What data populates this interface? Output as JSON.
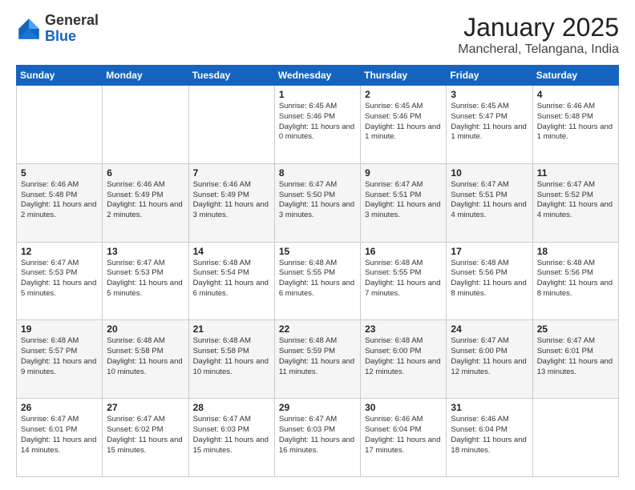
{
  "header": {
    "logo_general": "General",
    "logo_blue": "Blue",
    "month": "January 2025",
    "location": "Mancheral, Telangana, India"
  },
  "days_of_week": [
    "Sunday",
    "Monday",
    "Tuesday",
    "Wednesday",
    "Thursday",
    "Friday",
    "Saturday"
  ],
  "weeks": [
    [
      {
        "day": "",
        "sunrise": "",
        "sunset": "",
        "daylight": ""
      },
      {
        "day": "",
        "sunrise": "",
        "sunset": "",
        "daylight": ""
      },
      {
        "day": "",
        "sunrise": "",
        "sunset": "",
        "daylight": ""
      },
      {
        "day": "1",
        "sunrise": "Sunrise: 6:45 AM",
        "sunset": "Sunset: 5:46 PM",
        "daylight": "Daylight: 11 hours and 0 minutes."
      },
      {
        "day": "2",
        "sunrise": "Sunrise: 6:45 AM",
        "sunset": "Sunset: 5:46 PM",
        "daylight": "Daylight: 11 hours and 1 minute."
      },
      {
        "day": "3",
        "sunrise": "Sunrise: 6:45 AM",
        "sunset": "Sunset: 5:47 PM",
        "daylight": "Daylight: 11 hours and 1 minute."
      },
      {
        "day": "4",
        "sunrise": "Sunrise: 6:46 AM",
        "sunset": "Sunset: 5:48 PM",
        "daylight": "Daylight: 11 hours and 1 minute."
      }
    ],
    [
      {
        "day": "5",
        "sunrise": "Sunrise: 6:46 AM",
        "sunset": "Sunset: 5:48 PM",
        "daylight": "Daylight: 11 hours and 2 minutes."
      },
      {
        "day": "6",
        "sunrise": "Sunrise: 6:46 AM",
        "sunset": "Sunset: 5:49 PM",
        "daylight": "Daylight: 11 hours and 2 minutes."
      },
      {
        "day": "7",
        "sunrise": "Sunrise: 6:46 AM",
        "sunset": "Sunset: 5:49 PM",
        "daylight": "Daylight: 11 hours and 3 minutes."
      },
      {
        "day": "8",
        "sunrise": "Sunrise: 6:47 AM",
        "sunset": "Sunset: 5:50 PM",
        "daylight": "Daylight: 11 hours and 3 minutes."
      },
      {
        "day": "9",
        "sunrise": "Sunrise: 6:47 AM",
        "sunset": "Sunset: 5:51 PM",
        "daylight": "Daylight: 11 hours and 3 minutes."
      },
      {
        "day": "10",
        "sunrise": "Sunrise: 6:47 AM",
        "sunset": "Sunset: 5:51 PM",
        "daylight": "Daylight: 11 hours and 4 minutes."
      },
      {
        "day": "11",
        "sunrise": "Sunrise: 6:47 AM",
        "sunset": "Sunset: 5:52 PM",
        "daylight": "Daylight: 11 hours and 4 minutes."
      }
    ],
    [
      {
        "day": "12",
        "sunrise": "Sunrise: 6:47 AM",
        "sunset": "Sunset: 5:53 PM",
        "daylight": "Daylight: 11 hours and 5 minutes."
      },
      {
        "day": "13",
        "sunrise": "Sunrise: 6:47 AM",
        "sunset": "Sunset: 5:53 PM",
        "daylight": "Daylight: 11 hours and 5 minutes."
      },
      {
        "day": "14",
        "sunrise": "Sunrise: 6:48 AM",
        "sunset": "Sunset: 5:54 PM",
        "daylight": "Daylight: 11 hours and 6 minutes."
      },
      {
        "day": "15",
        "sunrise": "Sunrise: 6:48 AM",
        "sunset": "Sunset: 5:55 PM",
        "daylight": "Daylight: 11 hours and 6 minutes."
      },
      {
        "day": "16",
        "sunrise": "Sunrise: 6:48 AM",
        "sunset": "Sunset: 5:55 PM",
        "daylight": "Daylight: 11 hours and 7 minutes."
      },
      {
        "day": "17",
        "sunrise": "Sunrise: 6:48 AM",
        "sunset": "Sunset: 5:56 PM",
        "daylight": "Daylight: 11 hours and 8 minutes."
      },
      {
        "day": "18",
        "sunrise": "Sunrise: 6:48 AM",
        "sunset": "Sunset: 5:56 PM",
        "daylight": "Daylight: 11 hours and 8 minutes."
      }
    ],
    [
      {
        "day": "19",
        "sunrise": "Sunrise: 6:48 AM",
        "sunset": "Sunset: 5:57 PM",
        "daylight": "Daylight: 11 hours and 9 minutes."
      },
      {
        "day": "20",
        "sunrise": "Sunrise: 6:48 AM",
        "sunset": "Sunset: 5:58 PM",
        "daylight": "Daylight: 11 hours and 10 minutes."
      },
      {
        "day": "21",
        "sunrise": "Sunrise: 6:48 AM",
        "sunset": "Sunset: 5:58 PM",
        "daylight": "Daylight: 11 hours and 10 minutes."
      },
      {
        "day": "22",
        "sunrise": "Sunrise: 6:48 AM",
        "sunset": "Sunset: 5:59 PM",
        "daylight": "Daylight: 11 hours and 11 minutes."
      },
      {
        "day": "23",
        "sunrise": "Sunrise: 6:48 AM",
        "sunset": "Sunset: 6:00 PM",
        "daylight": "Daylight: 11 hours and 12 minutes."
      },
      {
        "day": "24",
        "sunrise": "Sunrise: 6:47 AM",
        "sunset": "Sunset: 6:00 PM",
        "daylight": "Daylight: 11 hours and 12 minutes."
      },
      {
        "day": "25",
        "sunrise": "Sunrise: 6:47 AM",
        "sunset": "Sunset: 6:01 PM",
        "daylight": "Daylight: 11 hours and 13 minutes."
      }
    ],
    [
      {
        "day": "26",
        "sunrise": "Sunrise: 6:47 AM",
        "sunset": "Sunset: 6:01 PM",
        "daylight": "Daylight: 11 hours and 14 minutes."
      },
      {
        "day": "27",
        "sunrise": "Sunrise: 6:47 AM",
        "sunset": "Sunset: 6:02 PM",
        "daylight": "Daylight: 11 hours and 15 minutes."
      },
      {
        "day": "28",
        "sunrise": "Sunrise: 6:47 AM",
        "sunset": "Sunset: 6:03 PM",
        "daylight": "Daylight: 11 hours and 15 minutes."
      },
      {
        "day": "29",
        "sunrise": "Sunrise: 6:47 AM",
        "sunset": "Sunset: 6:03 PM",
        "daylight": "Daylight: 11 hours and 16 minutes."
      },
      {
        "day": "30",
        "sunrise": "Sunrise: 6:46 AM",
        "sunset": "Sunset: 6:04 PM",
        "daylight": "Daylight: 11 hours and 17 minutes."
      },
      {
        "day": "31",
        "sunrise": "Sunrise: 6:46 AM",
        "sunset": "Sunset: 6:04 PM",
        "daylight": "Daylight: 11 hours and 18 minutes."
      },
      {
        "day": "",
        "sunrise": "",
        "sunset": "",
        "daylight": ""
      }
    ]
  ]
}
